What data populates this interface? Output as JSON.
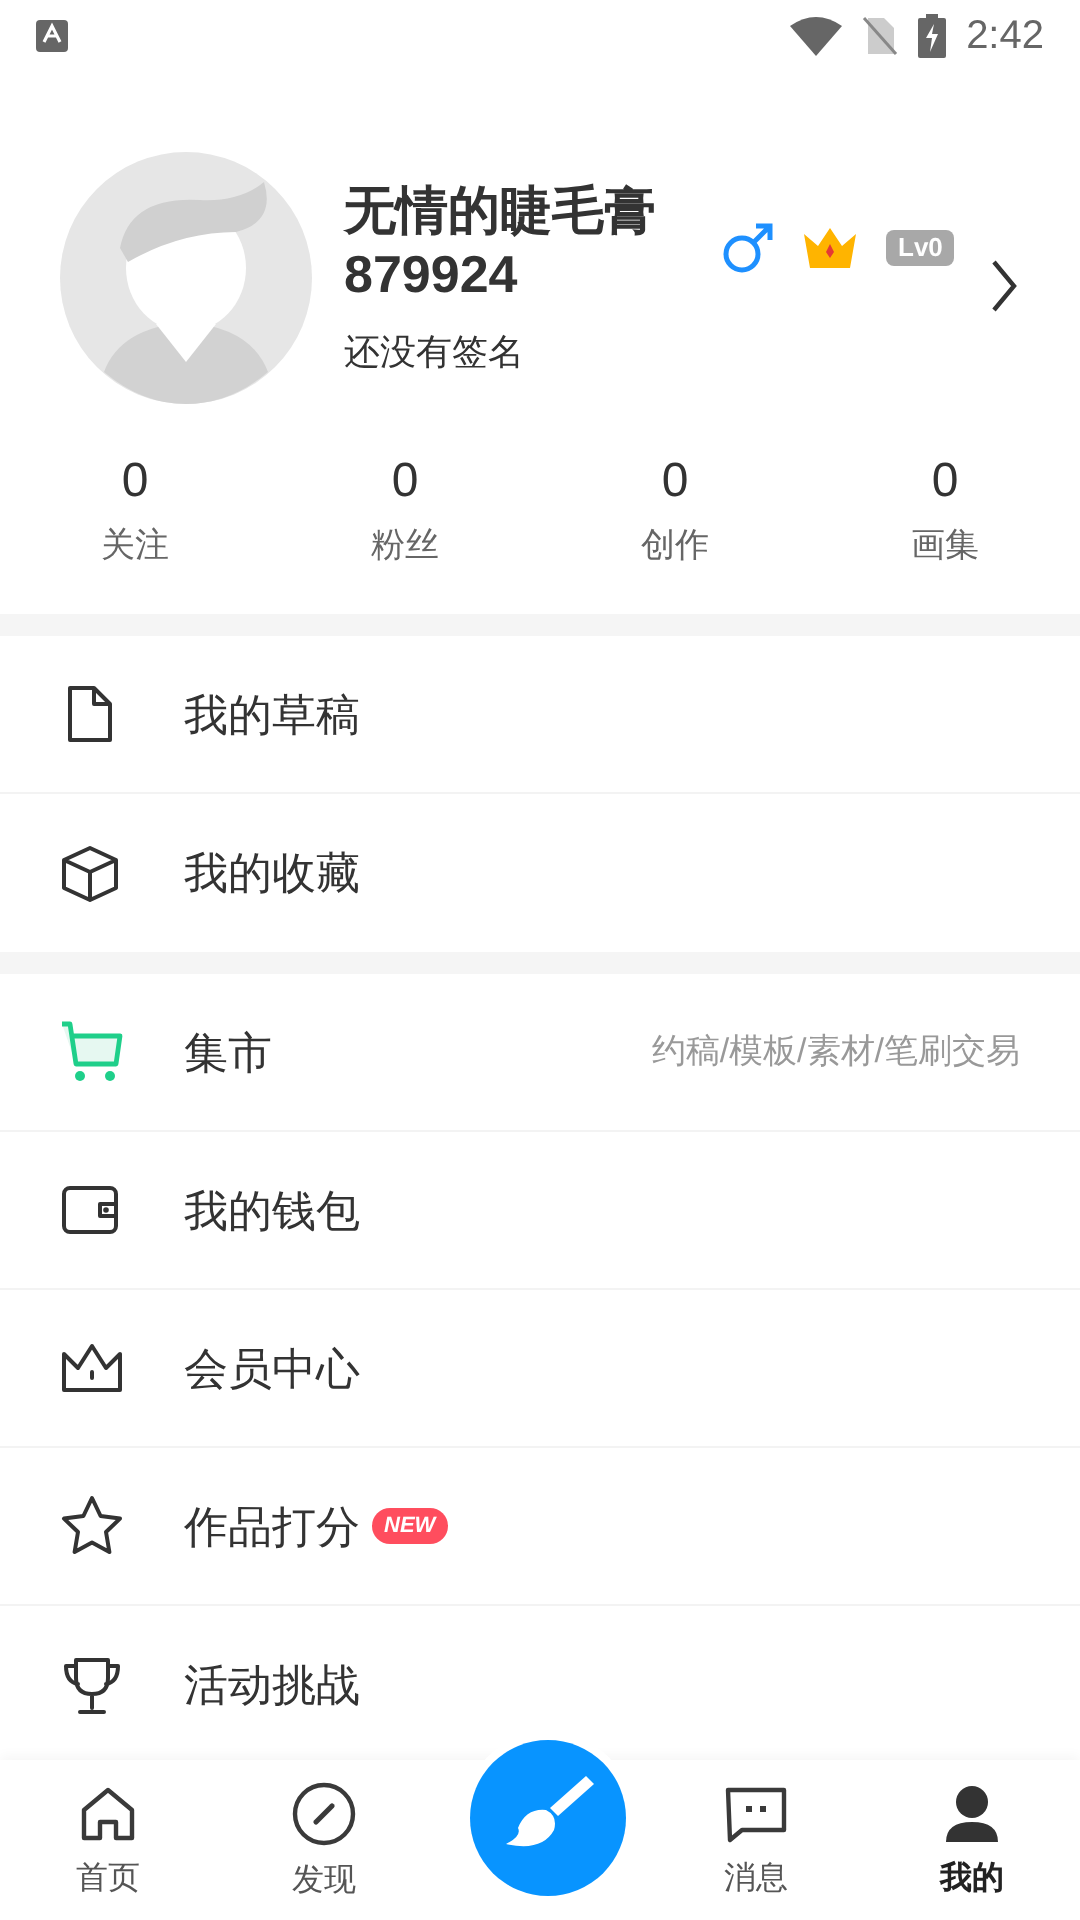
{
  "status_bar": {
    "time": "2:42"
  },
  "profile": {
    "name": "无情的睫毛膏",
    "id": "879924",
    "signature": "还没有签名",
    "level_badge": "Lv0"
  },
  "stats": [
    {
      "value": "0",
      "label": "关注"
    },
    {
      "value": "0",
      "label": "粉丝"
    },
    {
      "value": "0",
      "label": "创作"
    },
    {
      "value": "0",
      "label": "画集"
    }
  ],
  "menu_groups": [
    [
      {
        "label": "我的草稿"
      },
      {
        "label": "我的收藏"
      }
    ],
    [
      {
        "label": "集市",
        "hint": "约稿/模板/素材/笔刷交易"
      },
      {
        "label": "我的钱包"
      },
      {
        "label": "会员中心"
      },
      {
        "label": "作品打分",
        "badge": "NEW"
      },
      {
        "label": "活动挑战"
      }
    ]
  ],
  "bottom_nav": [
    {
      "label": "首页",
      "selected": false
    },
    {
      "label": "发现",
      "selected": false
    },
    {
      "label": "消息",
      "selected": false
    },
    {
      "label": "我的",
      "selected": true
    }
  ]
}
